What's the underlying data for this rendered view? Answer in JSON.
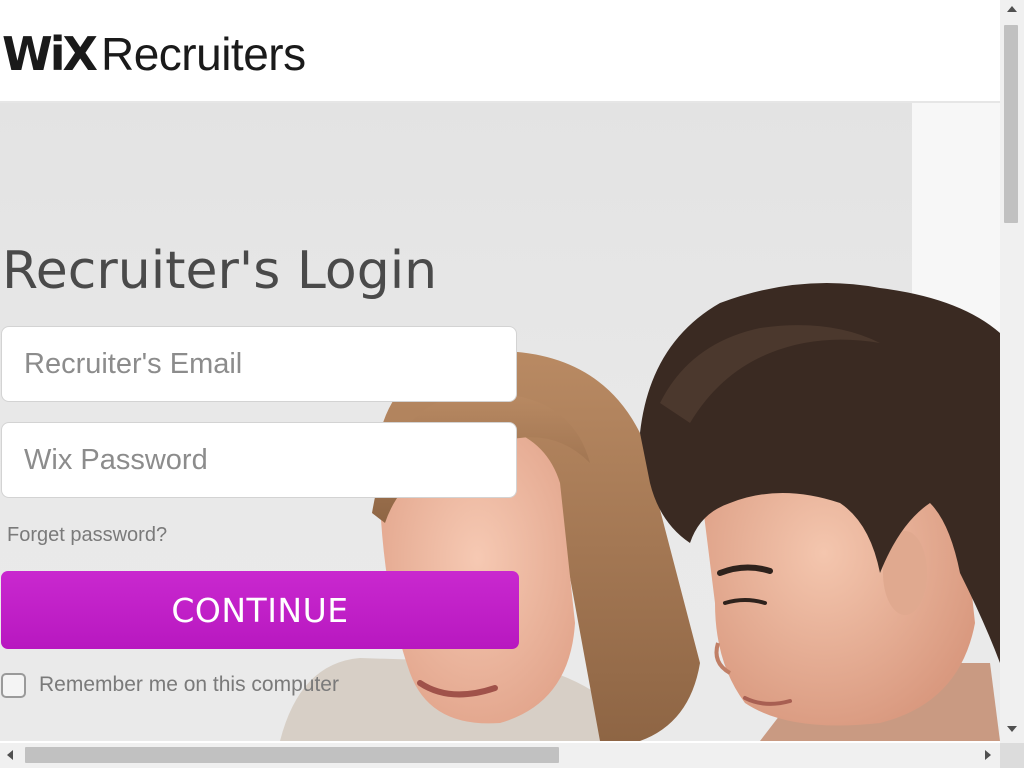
{
  "header": {
    "logo_mark": "WiX",
    "logo_product": "Recruiters"
  },
  "login": {
    "title": "Recruiter's Login",
    "email_placeholder": "Recruiter's Email",
    "email_value": "",
    "password_placeholder": "Wix Password",
    "password_value": "",
    "forgot_link": "Forget password?",
    "continue_label": "CONTINUE",
    "remember_label": "Remember me on this computer",
    "remember_checked": false
  },
  "colors": {
    "accent": "#c21fc9",
    "title_text": "#4a4a4a",
    "muted_text": "#7a7a7a"
  },
  "icons": [
    "scroll-up-arrow-icon",
    "scroll-down-arrow-icon",
    "scroll-left-arrow-icon",
    "scroll-right-arrow-icon"
  ]
}
